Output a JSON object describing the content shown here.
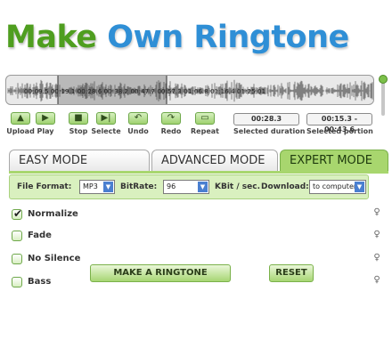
{
  "title": {
    "word1": "Make",
    "word2": "Own Ringtone"
  },
  "waveform": {
    "time_marks": "00:09.5  00:19.1  00:28.6  00:38.2  00:47.7  00:57.3  01:06.8  01:16.4  01:25  01"
  },
  "toolbar": [
    {
      "name": "upload",
      "label": "Upload",
      "icon": "upload-icon",
      "glyph": "▲"
    },
    {
      "name": "play",
      "label": "Play",
      "icon": "play-icon",
      "glyph": "▶"
    },
    {
      "name": "stop",
      "label": "Stop",
      "icon": "stop-icon",
      "glyph": "■"
    },
    {
      "name": "select",
      "label": "Selecte",
      "icon": "select-icon",
      "glyph": "▶|"
    },
    {
      "name": "undo",
      "label": "Undo",
      "icon": "undo-icon",
      "glyph": "↶"
    },
    {
      "name": "redo",
      "label": "Redo",
      "icon": "redo-icon",
      "glyph": "↷"
    },
    {
      "name": "repeat",
      "label": "Repeat",
      "icon": "repeat-icon",
      "glyph": "▭"
    }
  ],
  "selected_duration": {
    "value": "00:28.3",
    "label": "Selected duration"
  },
  "selected_portion": {
    "value": "00:15.3 - 00:43.6",
    "label": "Selected portion"
  },
  "tabs": [
    {
      "label": "EASY MODE",
      "active": false
    },
    {
      "label": "ADVANCED MODE",
      "active": false
    },
    {
      "label": "EXPERT MODE",
      "active": true
    }
  ],
  "options": {
    "file_format_label": "File Format:",
    "file_format_value": "MP3",
    "bitrate_label": "BitRate:",
    "bitrate_value": "96",
    "kbit_label": "KBit / sec.",
    "download_label": "Download:",
    "download_value": "to computer"
  },
  "checkboxes": [
    {
      "label": "Normalize",
      "checked": true
    },
    {
      "label": "Fade",
      "checked": false
    },
    {
      "label": "No Silence",
      "checked": false
    },
    {
      "label": "Bass",
      "checked": false
    }
  ],
  "buttons": {
    "make": "MAKE A RINGTONE",
    "reset": "RESET"
  },
  "colors": {
    "accent_green": "#a8d66e",
    "title_green": "#4f9e1f",
    "title_blue": "#2f8fd6"
  }
}
